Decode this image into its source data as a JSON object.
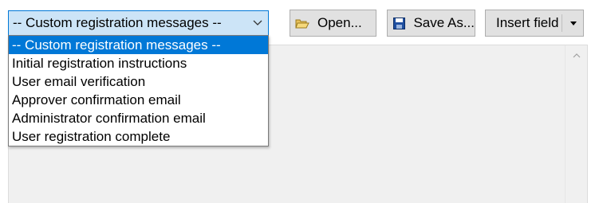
{
  "combo": {
    "selected": "-- Custom registration messages --",
    "options": [
      "-- Custom registration messages --",
      "Initial registration instructions",
      "User email verification",
      "Approver confirmation email",
      "Administrator confirmation email",
      "User registration complete"
    ],
    "highlighted_index": 0
  },
  "toolbar": {
    "open_label": "Open...",
    "save_label": "Save As...",
    "insert_label": "Insert field",
    "open_icon": "folder-open-icon",
    "save_icon": "floppy-disk-icon"
  },
  "colors": {
    "accent": "#0078d7",
    "combo_bg": "#cce4f7",
    "button_bg": "#e1e1e1",
    "editor_bg": "#f0f0f0"
  }
}
